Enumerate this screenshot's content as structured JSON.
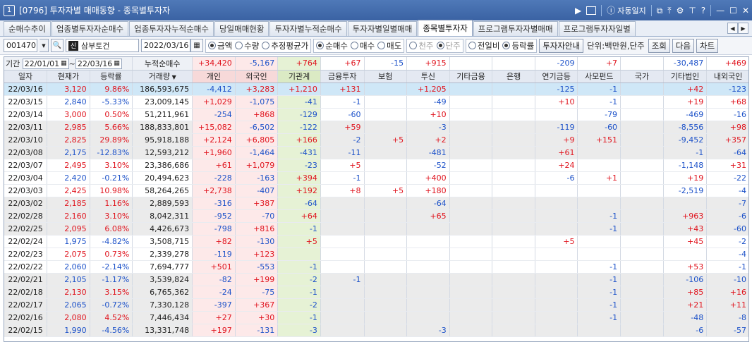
{
  "window": {
    "number": "1",
    "title": "[0796] 투자자별 매매동향 - 종목별투자자",
    "auto_label": "자동일지"
  },
  "tabs": [
    {
      "label": "순매수추이",
      "active": false
    },
    {
      "label": "업종별투자자순매수",
      "active": false
    },
    {
      "label": "업종투자자누적순매수",
      "active": false
    },
    {
      "label": "당일매매현황",
      "active": false
    },
    {
      "label": "투자자별누적순매수",
      "active": false
    },
    {
      "label": "투자자별일별매매",
      "active": false
    },
    {
      "label": "종목별투자자",
      "active": true
    },
    {
      "label": "프로그램투자자별매매",
      "active": false
    },
    {
      "label": "프로그램투자자일별",
      "active": false
    }
  ],
  "toolbar": {
    "code": "001470",
    "badge": "신",
    "stock_name": "삼부토건",
    "date": "2022/03/16",
    "radios_a": [
      {
        "label": "금액",
        "on": true
      },
      {
        "label": "수량",
        "on": false
      },
      {
        "label": "추정평균가",
        "on": false
      }
    ],
    "radios_b": [
      {
        "label": "순매수",
        "on": true
      },
      {
        "label": "매수",
        "on": false
      },
      {
        "label": "매도",
        "on": false
      }
    ],
    "radios_c": [
      {
        "label": "천주",
        "on": false,
        "disabled": true
      },
      {
        "label": "단주",
        "on": true,
        "disabled": true
      }
    ],
    "radios_d": [
      {
        "label": "전일비",
        "on": false
      },
      {
        "label": "등락률",
        "on": true
      }
    ],
    "info_button": "투자자안내",
    "unit": "단위:백만원,단주",
    "query_button": "조회",
    "next_button": "다음",
    "chart_button": "차트"
  },
  "summary": {
    "period_label": "기간",
    "from": "22/01/01",
    "sep": "~",
    "to": "22/03/16",
    "cumulative_label": "누적순매수",
    "values": [
      "+34,420",
      "-5,167",
      "+764",
      "+67",
      "-15",
      "+915",
      "",
      "",
      "-209",
      "+7",
      "",
      "-30,487",
      "+469"
    ]
  },
  "columns": [
    "일자",
    "현재가",
    "등락률",
    "거래량",
    "개인",
    "외국인",
    "기관계",
    "금융투자",
    "보험",
    "투신",
    "기타금융",
    "은행",
    "연기금등",
    "사모펀드",
    "국가",
    "기타법인",
    "내외국인"
  ],
  "rows": [
    [
      "22/03/16",
      "3,120",
      "9.86%",
      "186,593,675",
      "-4,412",
      "+3,283",
      "+1,210",
      "+131",
      "",
      "+1,205",
      "",
      "",
      "-125",
      "-1",
      "",
      "+42",
      "-123"
    ],
    [
      "22/03/15",
      "2,840",
      "-5.33%",
      "23,009,145",
      "+1,029",
      "-1,075",
      "-41",
      "-1",
      "",
      "-49",
      "",
      "",
      "+10",
      "-1",
      "",
      "+19",
      "+68"
    ],
    [
      "22/03/14",
      "3,000",
      "0.50%",
      "51,211,961",
      "-254",
      "+868",
      "-129",
      "-60",
      "",
      "+10",
      "",
      "",
      "",
      "-79",
      "",
      "-469",
      "-16"
    ],
    [
      "22/03/11",
      "2,985",
      "5.66%",
      "188,833,801",
      "+15,082",
      "-6,502",
      "-122",
      "+59",
      "",
      "-3",
      "",
      "",
      "-119",
      "-60",
      "",
      "-8,556",
      "+98"
    ],
    [
      "22/03/10",
      "2,825",
      "29.89%",
      "95,918,188",
      "+2,124",
      "+6,805",
      "+166",
      "-2",
      "+5",
      "+2",
      "",
      "",
      "+9",
      "+151",
      "",
      "-9,452",
      "+357"
    ],
    [
      "22/03/08",
      "2,175",
      "-12.83%",
      "12,593,212",
      "+1,960",
      "-1,464",
      "-431",
      "-11",
      "",
      "-481",
      "",
      "",
      "+61",
      "",
      "",
      "-1",
      "-64"
    ],
    [
      "22/03/07",
      "2,495",
      "3.10%",
      "23,386,686",
      "+61",
      "+1,079",
      "-23",
      "+5",
      "",
      "-52",
      "",
      "",
      "+24",
      "",
      "",
      "-1,148",
      "+31"
    ],
    [
      "22/03/04",
      "2,420",
      "-0.21%",
      "20,494,623",
      "-228",
      "-163",
      "+394",
      "-1",
      "",
      "+400",
      "",
      "",
      "-6",
      "+1",
      "",
      "+19",
      "-22"
    ],
    [
      "22/03/03",
      "2,425",
      "10.98%",
      "58,264,265",
      "+2,738",
      "-407",
      "+192",
      "+8",
      "+5",
      "+180",
      "",
      "",
      "",
      "",
      "",
      "-2,519",
      "-4"
    ],
    [
      "22/03/02",
      "2,185",
      "1.16%",
      "2,889,593",
      "-316",
      "+387",
      "-64",
      "",
      "",
      "-64",
      "",
      "",
      "",
      "",
      "",
      "",
      "-7"
    ],
    [
      "22/02/28",
      "2,160",
      "3.10%",
      "8,042,311",
      "-952",
      "-70",
      "+64",
      "",
      "",
      "+65",
      "",
      "",
      "",
      "-1",
      "",
      "+963",
      "-6"
    ],
    [
      "22/02/25",
      "2,095",
      "6.08%",
      "4,426,673",
      "-798",
      "+816",
      "-1",
      "",
      "",
      "",
      "",
      "",
      "",
      "-1",
      "",
      "+43",
      "-60"
    ],
    [
      "22/02/24",
      "1,975",
      "-4.82%",
      "3,508,715",
      "+82",
      "-130",
      "+5",
      "",
      "",
      "",
      "",
      "",
      "+5",
      "",
      "",
      "+45",
      "-2"
    ],
    [
      "22/02/23",
      "2,075",
      "0.73%",
      "2,339,278",
      "-119",
      "+123",
      "",
      "",
      "",
      "",
      "",
      "",
      "",
      "",
      "",
      "",
      "-4"
    ],
    [
      "22/02/22",
      "2,060",
      "-2.14%",
      "7,694,777",
      "+501",
      "-553",
      "-1",
      "",
      "",
      "",
      "",
      "",
      "",
      "-1",
      "",
      "+53",
      "-1"
    ],
    [
      "22/02/21",
      "2,105",
      "-1.17%",
      "3,539,824",
      "-82",
      "+199",
      "-2",
      "-1",
      "",
      "",
      "",
      "",
      "",
      "-1",
      "",
      "-106",
      "-10"
    ],
    [
      "22/02/18",
      "2,130",
      "3.15%",
      "6,765,362",
      "-24",
      "-75",
      "-1",
      "",
      "",
      "",
      "",
      "",
      "",
      "-1",
      "",
      "+85",
      "+16"
    ],
    [
      "22/02/17",
      "2,065",
      "-0.72%",
      "7,330,128",
      "-397",
      "+367",
      "-2",
      "",
      "",
      "",
      "",
      "",
      "",
      "-1",
      "",
      "+21",
      "+11"
    ],
    [
      "22/02/16",
      "2,080",
      "4.52%",
      "7,446,434",
      "+27",
      "+30",
      "-1",
      "",
      "",
      "",
      "",
      "",
      "",
      "-1",
      "",
      "-48",
      "-8"
    ],
    [
      "22/02/15",
      "1,990",
      "-4.56%",
      "13,331,748",
      "+197",
      "-131",
      "-3",
      "",
      "",
      "-3",
      "",
      "",
      "",
      "",
      "",
      "-6",
      "-57"
    ]
  ],
  "colors": {
    "up": "#e0141e",
    "down": "#1d52c9",
    "selected_row": "#cfe7f7",
    "alt_row": "#ebebeb",
    "titlebar": "#3a62a3"
  }
}
